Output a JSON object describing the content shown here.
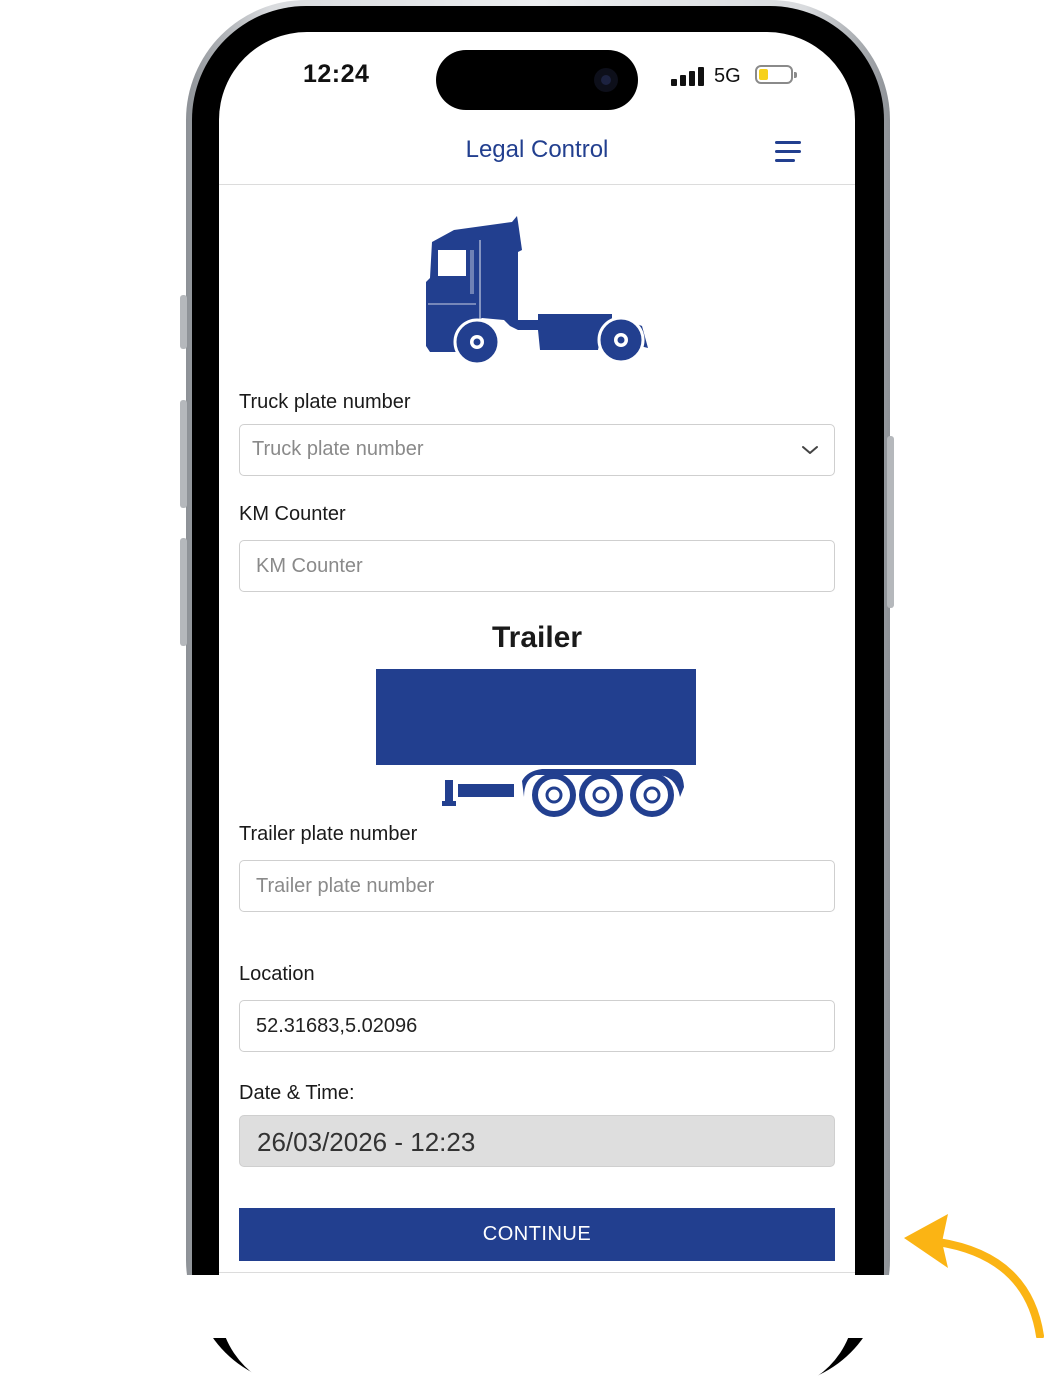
{
  "status_bar": {
    "time": "12:24",
    "network": "5G",
    "signal_icon": "cellular-signal-icon",
    "battery_icon": "battery-low-icon"
  },
  "header": {
    "title": "Legal Control",
    "menu_icon": "hamburger-menu-icon"
  },
  "truck_section": {
    "illustration": "truck-cab-icon",
    "plate_label": "Truck plate number",
    "plate_placeholder": "Truck plate number",
    "km_label": "KM Counter",
    "km_placeholder": "KM Counter"
  },
  "trailer_section": {
    "heading": "Trailer",
    "illustration": "trailer-icon",
    "plate_label": "Trailer plate number",
    "plate_placeholder": "Trailer plate number"
  },
  "location": {
    "label": "Location",
    "value": "52.31683,5.02096"
  },
  "datetime": {
    "label": "Date & Time:",
    "value": "26/03/2026 - 12:23"
  },
  "actions": {
    "continue_label": "CONTINUE"
  },
  "annotation": {
    "arrow_icon": "curved-arrow-icon",
    "arrow_color": "#fbb414"
  },
  "colors": {
    "brand": "#223f8f",
    "date_field_bg": "#dedede"
  }
}
